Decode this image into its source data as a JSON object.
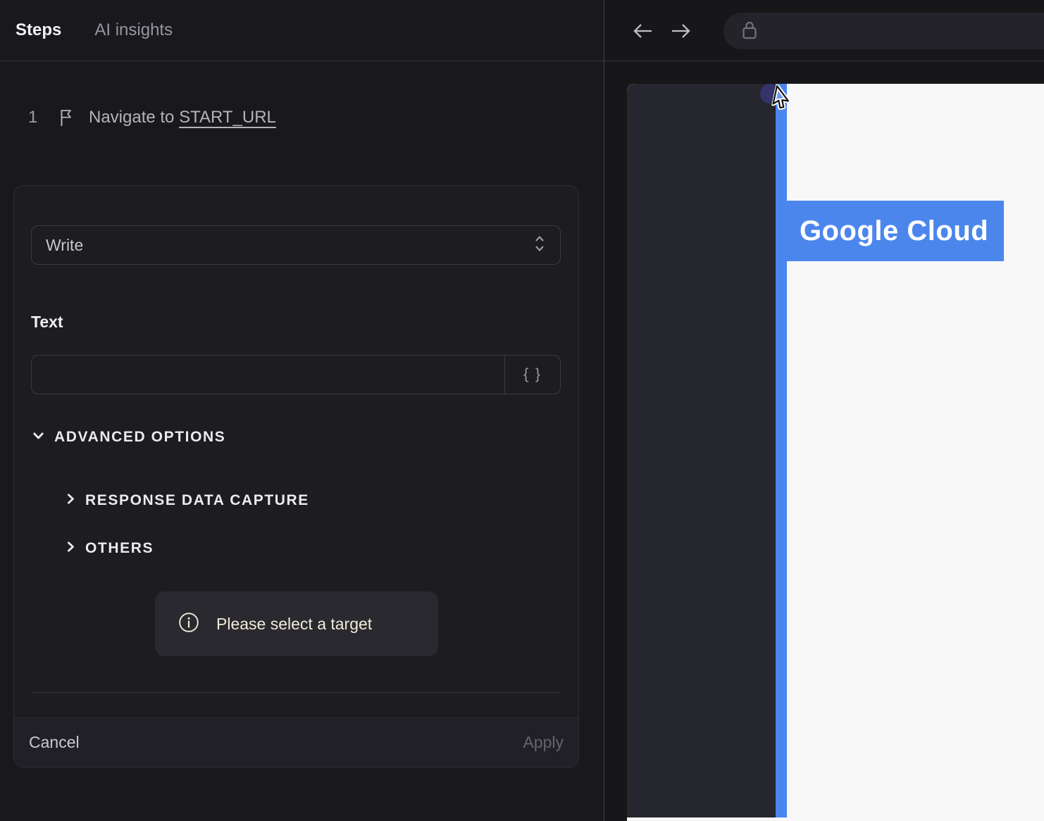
{
  "colors": {
    "accent_blue": "#4b86ec",
    "success_green": "#2fd14d",
    "notice_text": "#f1ead9",
    "sidebar_navy": "#26262f",
    "indigo_dot": "#34346b",
    "panel_dark": "#19191d"
  },
  "left_panel": {
    "tabs": [
      {
        "label": "Steps",
        "active": true
      },
      {
        "label": "AI insights",
        "active": false
      }
    ],
    "step": {
      "number": "1",
      "action": "Navigate to ",
      "target": "START_URL",
      "status": "success"
    },
    "editor": {
      "action_select": {
        "value": "Write"
      },
      "text_field": {
        "label": "Text",
        "value": "",
        "expression_button": "{ }"
      },
      "advanced": {
        "label": "ADVANCED OPTIONS",
        "expanded": true,
        "sections": [
          {
            "label": "RESPONSE DATA CAPTURE"
          },
          {
            "label": "OTHERS"
          }
        ]
      },
      "notice": {
        "text": "Please select a target"
      },
      "footer": {
        "cancel": "Cancel",
        "apply": "Apply"
      }
    }
  },
  "browser": {
    "url_bar_value": "",
    "page": {
      "brand": "Google Cloud"
    }
  }
}
